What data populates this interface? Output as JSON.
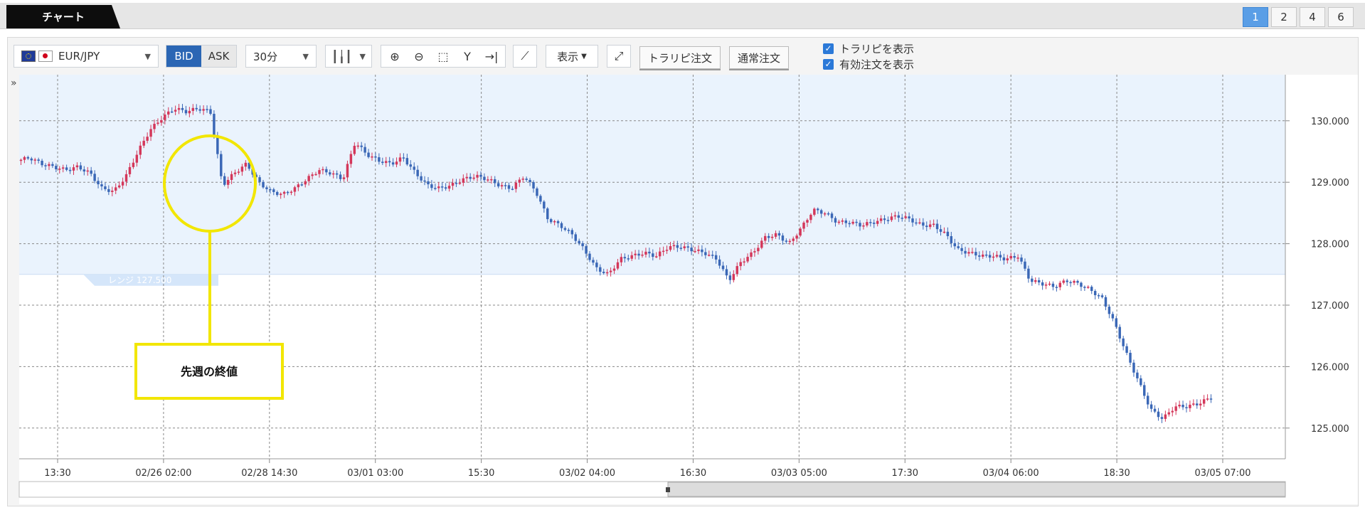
{
  "tab": {
    "label": "チャート"
  },
  "layout_buttons": [
    "1",
    "2",
    "4",
    "6"
  ],
  "layout_selected": "1",
  "toolbar": {
    "pair": "EUR/JPY",
    "bid_label": "BID",
    "ask_label": "ASK",
    "interval": "30分",
    "display_label": "表示",
    "trail_order": "トラリピ注文",
    "normal_order": "通常注文",
    "check_trail": "トラリピを表示",
    "check_valid": "有効注文を表示"
  },
  "colors": {
    "up": "#d4375a",
    "down": "#3a67b6",
    "range_fill": "#eaf3fd",
    "annotation": "#f2e600",
    "accent": "#2b66b4"
  },
  "icons": [
    "chevron-down-icon",
    "candlestick-icon",
    "zoom-in-icon",
    "zoom-out-icon",
    "zoom-fit-icon",
    "y-axis-scale-icon",
    "jump-latest-icon",
    "add-indicator-icon",
    "expand-icon",
    "check-icon",
    "collapse-left-icon",
    "collapse-right-icon"
  ],
  "chart": {
    "range_label": "レンジ 127.500",
    "annotation_label": "先週の終値"
  },
  "chart_data": {
    "type": "candlestick",
    "yticks": [
      "130.000",
      "129.000",
      "128.000",
      "127.000",
      "126.000",
      "125.000"
    ],
    "ylim": [
      124.5,
      130.75
    ],
    "xticks": [
      "13:30",
      "02/26 02:00",
      "02/28 14:30",
      "03/01 03:00",
      "15:30",
      "03/02 04:00",
      "16:30",
      "03/03 05:00",
      "17:30",
      "03/04 06:00",
      "18:30",
      "03/05 07:00"
    ],
    "range_band": {
      "from": 127.5,
      "to": 130.75
    },
    "path": [
      129.35,
      129.4,
      129.3,
      129.25,
      129.2,
      129.25,
      129.15,
      128.9,
      128.85,
      129.1,
      129.5,
      129.85,
      130.05,
      130.2,
      130.15,
      130.2,
      130.15,
      128.95,
      129.15,
      129.3,
      129.0,
      128.85,
      128.8,
      128.9,
      129.05,
      129.2,
      129.15,
      129.05,
      129.65,
      129.45,
      129.35,
      129.3,
      129.4,
      129.15,
      128.95,
      128.9,
      128.95,
      129.05,
      129.1,
      129.05,
      128.95,
      128.9,
      129.1,
      128.85,
      128.4,
      128.3,
      128.15,
      127.9,
      127.6,
      127.5,
      127.75,
      127.8,
      127.85,
      127.8,
      127.95,
      127.95,
      127.9,
      127.85,
      127.75,
      127.4,
      127.7,
      127.85,
      128.1,
      128.15,
      128.0,
      128.25,
      128.55,
      128.5,
      128.35,
      128.35,
      128.3,
      128.35,
      128.4,
      128.45,
      128.4,
      128.3,
      128.3,
      128.15,
      127.9,
      127.85,
      127.8,
      127.8,
      127.75,
      127.8,
      127.4,
      127.35,
      127.3,
      127.4,
      127.35,
      127.25,
      127.1,
      126.7,
      126.2,
      125.75,
      125.3,
      125.15,
      125.35,
      125.35,
      125.4,
      125.5
    ]
  }
}
